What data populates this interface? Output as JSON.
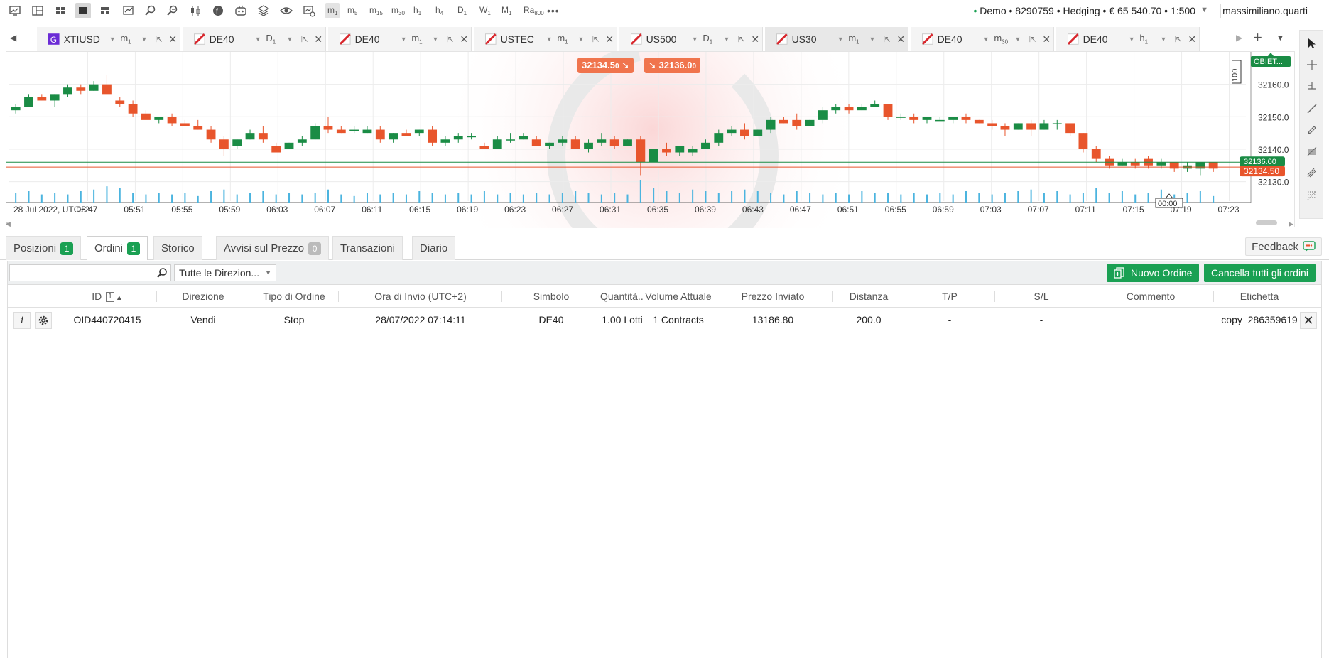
{
  "toolbar": {
    "timeframes": [
      {
        "base": "m",
        "sub": "1",
        "active": true
      },
      {
        "base": "m",
        "sub": "5"
      },
      {
        "base": "m",
        "sub": "15"
      },
      {
        "base": "m",
        "sub": "30"
      },
      {
        "base": "h",
        "sub": "1"
      },
      {
        "base": "h",
        "sub": "4"
      },
      {
        "base": "D",
        "sub": "1"
      },
      {
        "base": "W",
        "sub": "1"
      },
      {
        "base": "M",
        "sub": "1"
      },
      {
        "base": "Ra",
        "sub": "800"
      }
    ],
    "more": "•••",
    "account": "Demo • 8290759 • Hedging • € 65 540.70 • 1:500",
    "account_dot": "•",
    "user": "massimiliano.quarti"
  },
  "tabs": [
    {
      "symbol": "XTIUSD",
      "tf": "m",
      "tf_sub": "1",
      "icon": "purple"
    },
    {
      "symbol": "DE40",
      "tf": "D",
      "tf_sub": "1"
    },
    {
      "symbol": "DE40",
      "tf": "m",
      "tf_sub": "1"
    },
    {
      "symbol": "USTEC",
      "tf": "m",
      "tf_sub": "1"
    },
    {
      "symbol": "US500",
      "tf": "D",
      "tf_sub": "1"
    },
    {
      "symbol": "US30",
      "tf": "m",
      "tf_sub": "1",
      "active": true
    },
    {
      "symbol": "DE40",
      "tf": "m",
      "tf_sub": "30"
    },
    {
      "symbol": "DE40",
      "tf": "h",
      "tf_sub": "1"
    }
  ],
  "chart": {
    "bid_pill": "32134.5",
    "bid_pill_small": "0",
    "ask_pill": "32136.0",
    "ask_pill_small": "0",
    "objective_label": "OBIET...",
    "scale_label": "100",
    "current_price_label": "32134.50",
    "ask_price_label": "32136.00",
    "countdown": "00:00",
    "colors": {
      "bull": "#1a8c45",
      "bear": "#e8552c",
      "volume": "#4bb4df"
    }
  },
  "chart_data": {
    "type": "candlestick",
    "title": "US30 m1",
    "y_ticks": [
      "32160.0",
      "32150.0",
      "32140.0",
      "32130.0"
    ],
    "ylim": [
      32124,
      32170
    ],
    "x_ticks": [
      "28 Jul 2022, UTC+2",
      "05:47",
      "05:51",
      "05:55",
      "05:59",
      "06:03",
      "06:07",
      "06:11",
      "06:15",
      "06:19",
      "06:23",
      "06:27",
      "06:31",
      "06:35",
      "06:39",
      "06:43",
      "06:47",
      "06:51",
      "06:55",
      "06:59",
      "07:03",
      "07:07",
      "07:11",
      "07:15",
      "07:19",
      "07:23"
    ],
    "candles": [
      [
        32152,
        32154,
        32151,
        32153
      ],
      [
        32153,
        32157,
        32153,
        32156
      ],
      [
        32156,
        32157,
        32155,
        32155
      ],
      [
        32155,
        32157,
        32153,
        32157
      ],
      [
        32157,
        32160,
        32156,
        32159
      ],
      [
        32159,
        32160,
        32157,
        32158
      ],
      [
        32158,
        32161,
        32158,
        32160
      ],
      [
        32160,
        32163,
        32157,
        32157
      ],
      [
        32155,
        32156,
        32153,
        32154
      ],
      [
        32154,
        32155,
        32150,
        32151
      ],
      [
        32151,
        32152,
        32149,
        32149
      ],
      [
        32149,
        32150,
        32148,
        32150
      ],
      [
        32150,
        32151,
        32147,
        32148
      ],
      [
        32148,
        32149,
        32147,
        32147
      ],
      [
        32147,
        32149,
        32146,
        32146
      ],
      [
        32146,
        32147,
        32142,
        32143
      ],
      [
        32143,
        32144,
        32138,
        32140
      ],
      [
        32141,
        32143,
        32140,
        32143
      ],
      [
        32143,
        32146,
        32143,
        32145
      ],
      [
        32145,
        32147,
        32142,
        32143
      ],
      [
        32141,
        32142,
        32139,
        32139
      ],
      [
        32140,
        32142,
        32140,
        32142
      ],
      [
        32142,
        32144,
        32141,
        32143
      ],
      [
        32143,
        32148,
        32143,
        32147
      ],
      [
        32147,
        32150,
        32145,
        32146
      ],
      [
        32146,
        32147,
        32145,
        32145
      ],
      [
        32146,
        32147,
        32145,
        32146
      ],
      [
        32145,
        32147,
        32145,
        32146
      ],
      [
        32146,
        32147,
        32142,
        32143
      ],
      [
        32143,
        32145,
        32142,
        32145
      ],
      [
        32145,
        32146,
        32144,
        32144
      ],
      [
        32145,
        32146,
        32144,
        32146
      ],
      [
        32146,
        32147,
        32141,
        32142
      ],
      [
        32142,
        32144,
        32141,
        32143
      ],
      [
        32143,
        32145,
        32142,
        32144
      ],
      [
        32144,
        32145,
        32143,
        32144
      ],
      [
        32141,
        32142,
        32140,
        32140
      ],
      [
        32140,
        32144,
        32140,
        32143
      ],
      [
        32143,
        32145,
        32142,
        32143
      ],
      [
        32143,
        32145,
        32143,
        32144
      ],
      [
        32143,
        32144,
        32141,
        32141
      ],
      [
        32141,
        32142,
        32140,
        32142
      ],
      [
        32142,
        32144,
        32141,
        32143
      ],
      [
        32143,
        32144,
        32140,
        32140
      ],
      [
        32140,
        32143,
        32139,
        32142
      ],
      [
        32142,
        32145,
        32141,
        32143
      ],
      [
        32143,
        32144,
        32140,
        32141
      ],
      [
        32141,
        32143,
        32141,
        32143
      ],
      [
        32143,
        32144,
        32132,
        32136
      ],
      [
        32136,
        32140,
        32136,
        32140
      ],
      [
        32140,
        32142,
        32138,
        32139
      ],
      [
        32139,
        32141,
        32138,
        32141
      ],
      [
        32139,
        32141,
        32138,
        32140
      ],
      [
        32140,
        32143,
        32140,
        32142
      ],
      [
        32142,
        32146,
        32141,
        32145
      ],
      [
        32145,
        32147,
        32144,
        32146
      ],
      [
        32146,
        32148,
        32143,
        32144
      ],
      [
        32144,
        32146,
        32144,
        32146
      ],
      [
        32146,
        32150,
        32145,
        32149
      ],
      [
        32149,
        32150,
        32148,
        32148
      ],
      [
        32149,
        32151,
        32146,
        32147
      ],
      [
        32147,
        32149,
        32147,
        32149
      ],
      [
        32149,
        32153,
        32148,
        32152
      ],
      [
        32152,
        32154,
        32151,
        32153
      ],
      [
        32153,
        32154,
        32151,
        32152
      ],
      [
        32152,
        32154,
        32152,
        32153
      ],
      [
        32153,
        32155,
        32153,
        32154
      ],
      [
        32154,
        32154,
        32149,
        32150
      ],
      [
        32150,
        32151,
        32149,
        32150
      ],
      [
        32150,
        32151,
        32148,
        32149
      ],
      [
        32149,
        32150,
        32148,
        32150
      ],
      [
        32149,
        32150,
        32149,
        32149
      ],
      [
        32149,
        32150,
        32148,
        32150
      ],
      [
        32150,
        32151,
        32148,
        32149
      ],
      [
        32149,
        32149,
        32148,
        32148
      ],
      [
        32148,
        32149,
        32146,
        32147
      ],
      [
        32147,
        32148,
        32144,
        32146
      ],
      [
        32146,
        32148,
        32146,
        32148
      ],
      [
        32148,
        32149,
        32144,
        32146
      ],
      [
        32146,
        32149,
        32146,
        32148
      ],
      [
        32148,
        32149,
        32146,
        32148
      ],
      [
        32148,
        32148,
        32144,
        32145
      ],
      [
        32145,
        32145,
        32139,
        32140
      ],
      [
        32140,
        32141,
        32136,
        32137
      ],
      [
        32137,
        32138,
        32134,
        32135
      ],
      [
        32135,
        32137,
        32135,
        32136
      ],
      [
        32136,
        32137,
        32134,
        32135
      ],
      [
        32137,
        32138,
        32134,
        32135
      ],
      [
        32135,
        32137,
        32134,
        32136
      ],
      [
        32136,
        32136,
        32133,
        32134
      ],
      [
        32134,
        32136,
        32133,
        32135
      ],
      [
        32134,
        32136,
        32132,
        32136
      ],
      [
        32136,
        32136,
        32133,
        32134
      ]
    ],
    "volumes": [
      6,
      7,
      5,
      6,
      5,
      7,
      8,
      10,
      9,
      6,
      5,
      6,
      5,
      6,
      4,
      7,
      8,
      5,
      6,
      7,
      5,
      6,
      5,
      6,
      8,
      5,
      4,
      6,
      5,
      6,
      5,
      7,
      6,
      5,
      6,
      5,
      7,
      5,
      6,
      5,
      6,
      5,
      6,
      7,
      6,
      5,
      6,
      5,
      14,
      9,
      7,
      6,
      8,
      7,
      6,
      7,
      8,
      7,
      6,
      5,
      7,
      6,
      5,
      6,
      5,
      7,
      6,
      6,
      5,
      6,
      5,
      6,
      5,
      7,
      6,
      5,
      6,
      7,
      8,
      6,
      7,
      5,
      6,
      9,
      6,
      7,
      5,
      6,
      8,
      5,
      6,
      7,
      4
    ]
  },
  "panel": {
    "tabs": [
      {
        "label": "Posizioni",
        "badge": "1",
        "badge_color": "green"
      },
      {
        "label": "Ordini",
        "badge": "1",
        "badge_color": "green",
        "active": true
      },
      {
        "label": "Storico"
      },
      {
        "label": "Avvisi sul Prezzo",
        "badge": "0",
        "badge_color": "gray"
      },
      {
        "label": "Transazioni"
      },
      {
        "label": "Diario"
      }
    ],
    "feedback": "Feedback",
    "search_placeholder": "",
    "direction_filter": "Tutte le Direzion...",
    "new_order": "Nuovo Ordine",
    "cancel_all": "Cancella tutti gli ordini"
  },
  "orders": {
    "columns": [
      "ID",
      "Direzione",
      "Tipo di Ordine",
      "Ora di Invio (UTC+2)",
      "Simbolo",
      "Quantità...",
      "Volume Attuale",
      "Prezzo Inviato",
      "Distanza",
      "T/P",
      "S/L",
      "Commento",
      "Etichetta"
    ],
    "sort_index": "1",
    "sort_arrow": "▲",
    "rows": [
      {
        "id": "OID440720415",
        "direction": "Vendi",
        "type": "Stop",
        "time": "28/07/2022 07:14:11",
        "symbol": "DE40",
        "qty": "1.00 Lotti",
        "volume": "1 Contracts",
        "price": "13186.80",
        "distance": "200.0",
        "tp": "-",
        "sl": "-",
        "comment": "",
        "label": "copy_286359619"
      }
    ]
  }
}
